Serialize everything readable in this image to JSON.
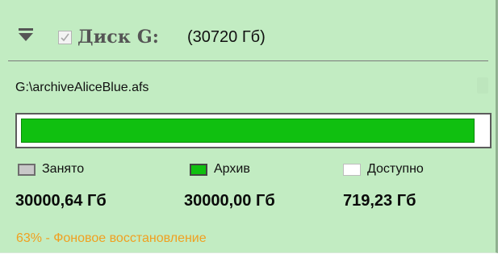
{
  "disk": {
    "name": "Диск G:",
    "size": "(30720 Гб)",
    "checked": true,
    "path": "G:\\archiveAliceBlue.afs"
  },
  "progress": {
    "fill_fraction": 0.975,
    "fill_color": "#10c010"
  },
  "legend": {
    "used_label": "Занято",
    "archive_label": "Архив",
    "free_label": "Доступно"
  },
  "values": {
    "used": "30000,64 Гб",
    "archive": "30000,00 Гб",
    "free": "719,23 Гб"
  },
  "status": {
    "text": "63% - Фоновое восстановление",
    "color": "#f0a020"
  },
  "colors": {
    "panel_background": "#c2ecc2",
    "archive": "#10c010",
    "used": "#c8c8c8",
    "free": "#ffffff"
  },
  "icons": {
    "collapse": "collapse-chevron-icon",
    "checkbox": "checkmark-icon"
  }
}
